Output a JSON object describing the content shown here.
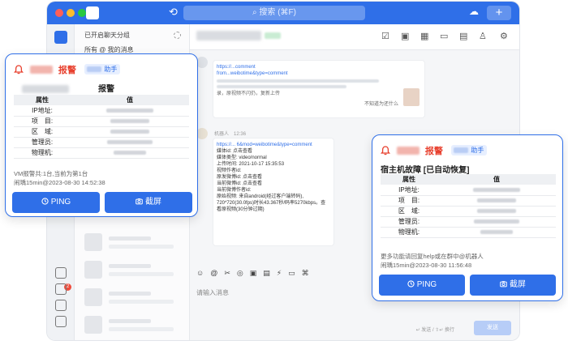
{
  "app": {
    "search_placeholder": "搜索 (⌘F)",
    "plus_label": "+",
    "conv_list": {
      "group_toggle": "已开启聊天分组",
      "mentions": "所有 @ 我的消息"
    },
    "chat": {
      "msg1_link": "https://...comment",
      "msg1_from": "from...weibotime&type=comment",
      "msg1_foot": "录，原视频不闪仍，复新上传",
      "msg1_side": "不知道为还什么",
      "bot_label": "机器人",
      "time_label": "12:36",
      "msg2_link": "https://... 6&mod=weibotime&type=comment",
      "msg2_items": [
        "媒体id: 点击查看",
        "媒体类型: video/normal",
        "上传时间: 2021-10-17 15:35:53",
        "视频作者id:",
        "原发微博id: 点击查看",
        "当前微博id: 点击查看",
        "当前微博作者id:",
        "原始视频: 来自android(经过客户端转码), 720*720(30.0fps)时长43.367秒/码率5270kbps。查看原视频(30分钟过期)"
      ],
      "input_placeholder": "请输入消息",
      "send_hint": "↵ 发送 / ⇧↵ 换行",
      "send_label": "发送"
    }
  },
  "card_left": {
    "alarm_word": "报警",
    "helper_label": "助手",
    "heading_suffix": "报警",
    "table_header": {
      "key": "属性",
      "value": "值"
    },
    "rows": [
      {
        "key": "IP地址:"
      },
      {
        "key": "项　目:"
      },
      {
        "key": "区　域:"
      },
      {
        "key": "管理员:"
      },
      {
        "key": "物理机:"
      }
    ],
    "footer_line1": "VM报警共:1台,当前为第1台",
    "footer_line2": "闹瑀15min@2023-08-30 14:52:38",
    "ping_label": "PING",
    "screenshot_label": "截屏"
  },
  "card_right": {
    "alarm_word": "报警",
    "helper_label": "助手",
    "heading": "宿主机故障 [已自动恢复]",
    "table_header": {
      "key": "属性",
      "value": "值"
    },
    "rows": [
      {
        "key": "IP地址:"
      },
      {
        "key": "项　目:"
      },
      {
        "key": "区　域:"
      },
      {
        "key": "管理员:"
      },
      {
        "key": "物理机:"
      }
    ],
    "footer_line1": "更多功能请回复help或在群中@机器人",
    "footer_line2": "闹瑀15min@2023-08-30 11:56:48",
    "ping_label": "PING",
    "screenshot_label": "截屏"
  },
  "colors": {
    "primary": "#2f6fe8",
    "alarm": "#e8412f"
  },
  "icons": [
    "bell-icon",
    "ping-icon",
    "camera-icon",
    "history-icon",
    "search-icon"
  ]
}
